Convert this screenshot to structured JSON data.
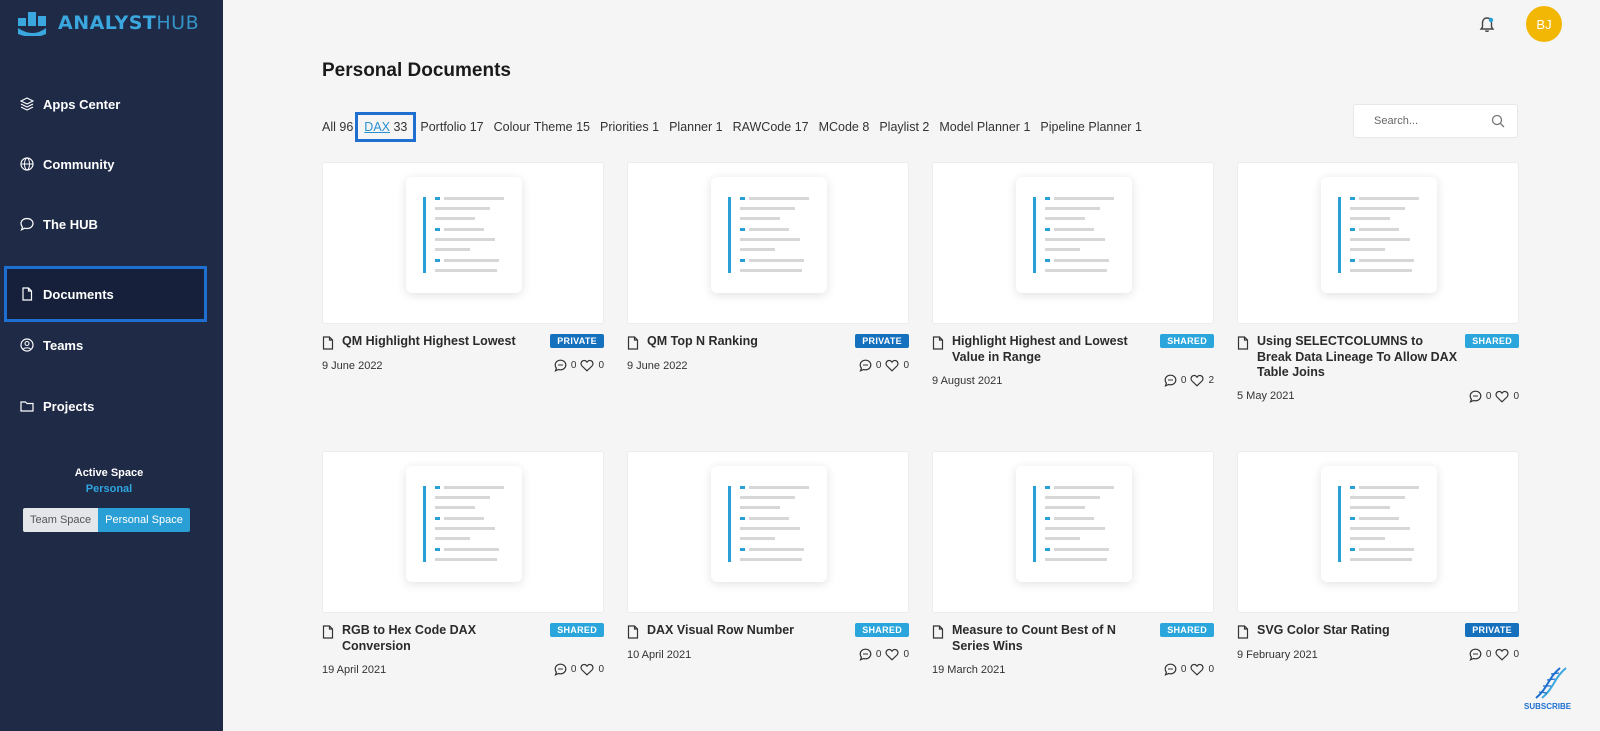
{
  "app": {
    "brand_primary": "ANALYST",
    "brand_secondary": "HUB",
    "accent_color": "#2a9fd6"
  },
  "sidebar": {
    "items": [
      {
        "label": "Apps Center",
        "icon": "layers-icon"
      },
      {
        "label": "Community",
        "icon": "globe-icon"
      },
      {
        "label": "The HUB",
        "icon": "chat-bubble-icon"
      },
      {
        "label": "Documents",
        "icon": "document-icon",
        "active": true
      },
      {
        "label": "Teams",
        "icon": "user-circle-icon"
      },
      {
        "label": "Projects",
        "icon": "folder-icon"
      }
    ],
    "active_space_label": "Active Space",
    "active_space_value": "Personal",
    "team_space_label": "Team Space",
    "personal_space_label": "Personal Space"
  },
  "header": {
    "avatar_initials": "BJ"
  },
  "main": {
    "title": "Personal Documents",
    "filters": [
      {
        "name": "All",
        "count": "96"
      },
      {
        "name": "DAX",
        "count": "33",
        "selected": true
      },
      {
        "name": "Portfolio",
        "count": "17"
      },
      {
        "name": "Colour Theme",
        "count": "15"
      },
      {
        "name": "Priorities",
        "count": "1"
      },
      {
        "name": "Planner",
        "count": "1"
      },
      {
        "name": "RAWCode",
        "count": "17"
      },
      {
        "name": "MCode",
        "count": "8"
      },
      {
        "name": "Playlist",
        "count": "2"
      },
      {
        "name": "Model Planner",
        "count": "1"
      },
      {
        "name": "Pipeline Planner",
        "count": "1"
      }
    ],
    "search_placeholder": "Search...",
    "documents": [
      {
        "title": "QM Highlight Highest Lowest",
        "badge": "PRIVATE",
        "date": "9 June 2022",
        "comments": "0",
        "likes": "0"
      },
      {
        "title": "QM Top N Ranking",
        "badge": "PRIVATE",
        "date": "9 June 2022",
        "comments": "0",
        "likes": "0"
      },
      {
        "title": "Highlight Highest and Lowest Value in Range",
        "badge": "SHARED",
        "date": "9 August 2021",
        "comments": "0",
        "likes": "2"
      },
      {
        "title": "Using SELECTCOLUMNS to Break Data Lineage To Allow DAX Table Joins",
        "badge": "SHARED",
        "date": "5 May 2021",
        "comments": "0",
        "likes": "0"
      },
      {
        "title": "RGB to Hex Code DAX Conversion",
        "badge": "SHARED",
        "date": "19 April 2021",
        "comments": "0",
        "likes": "0"
      },
      {
        "title": "DAX Visual Row Number",
        "badge": "SHARED",
        "date": "10 April 2021",
        "comments": "0",
        "likes": "0"
      },
      {
        "title": "Measure to Count Best of N Series Wins",
        "badge": "SHARED",
        "date": "19 March 2021",
        "comments": "0",
        "likes": "0"
      },
      {
        "title": "SVG Color Star Rating",
        "badge": "PRIVATE",
        "date": "9 February 2021",
        "comments": "0",
        "likes": "0"
      }
    ]
  },
  "subscribe_label": "SUBSCRIBE"
}
